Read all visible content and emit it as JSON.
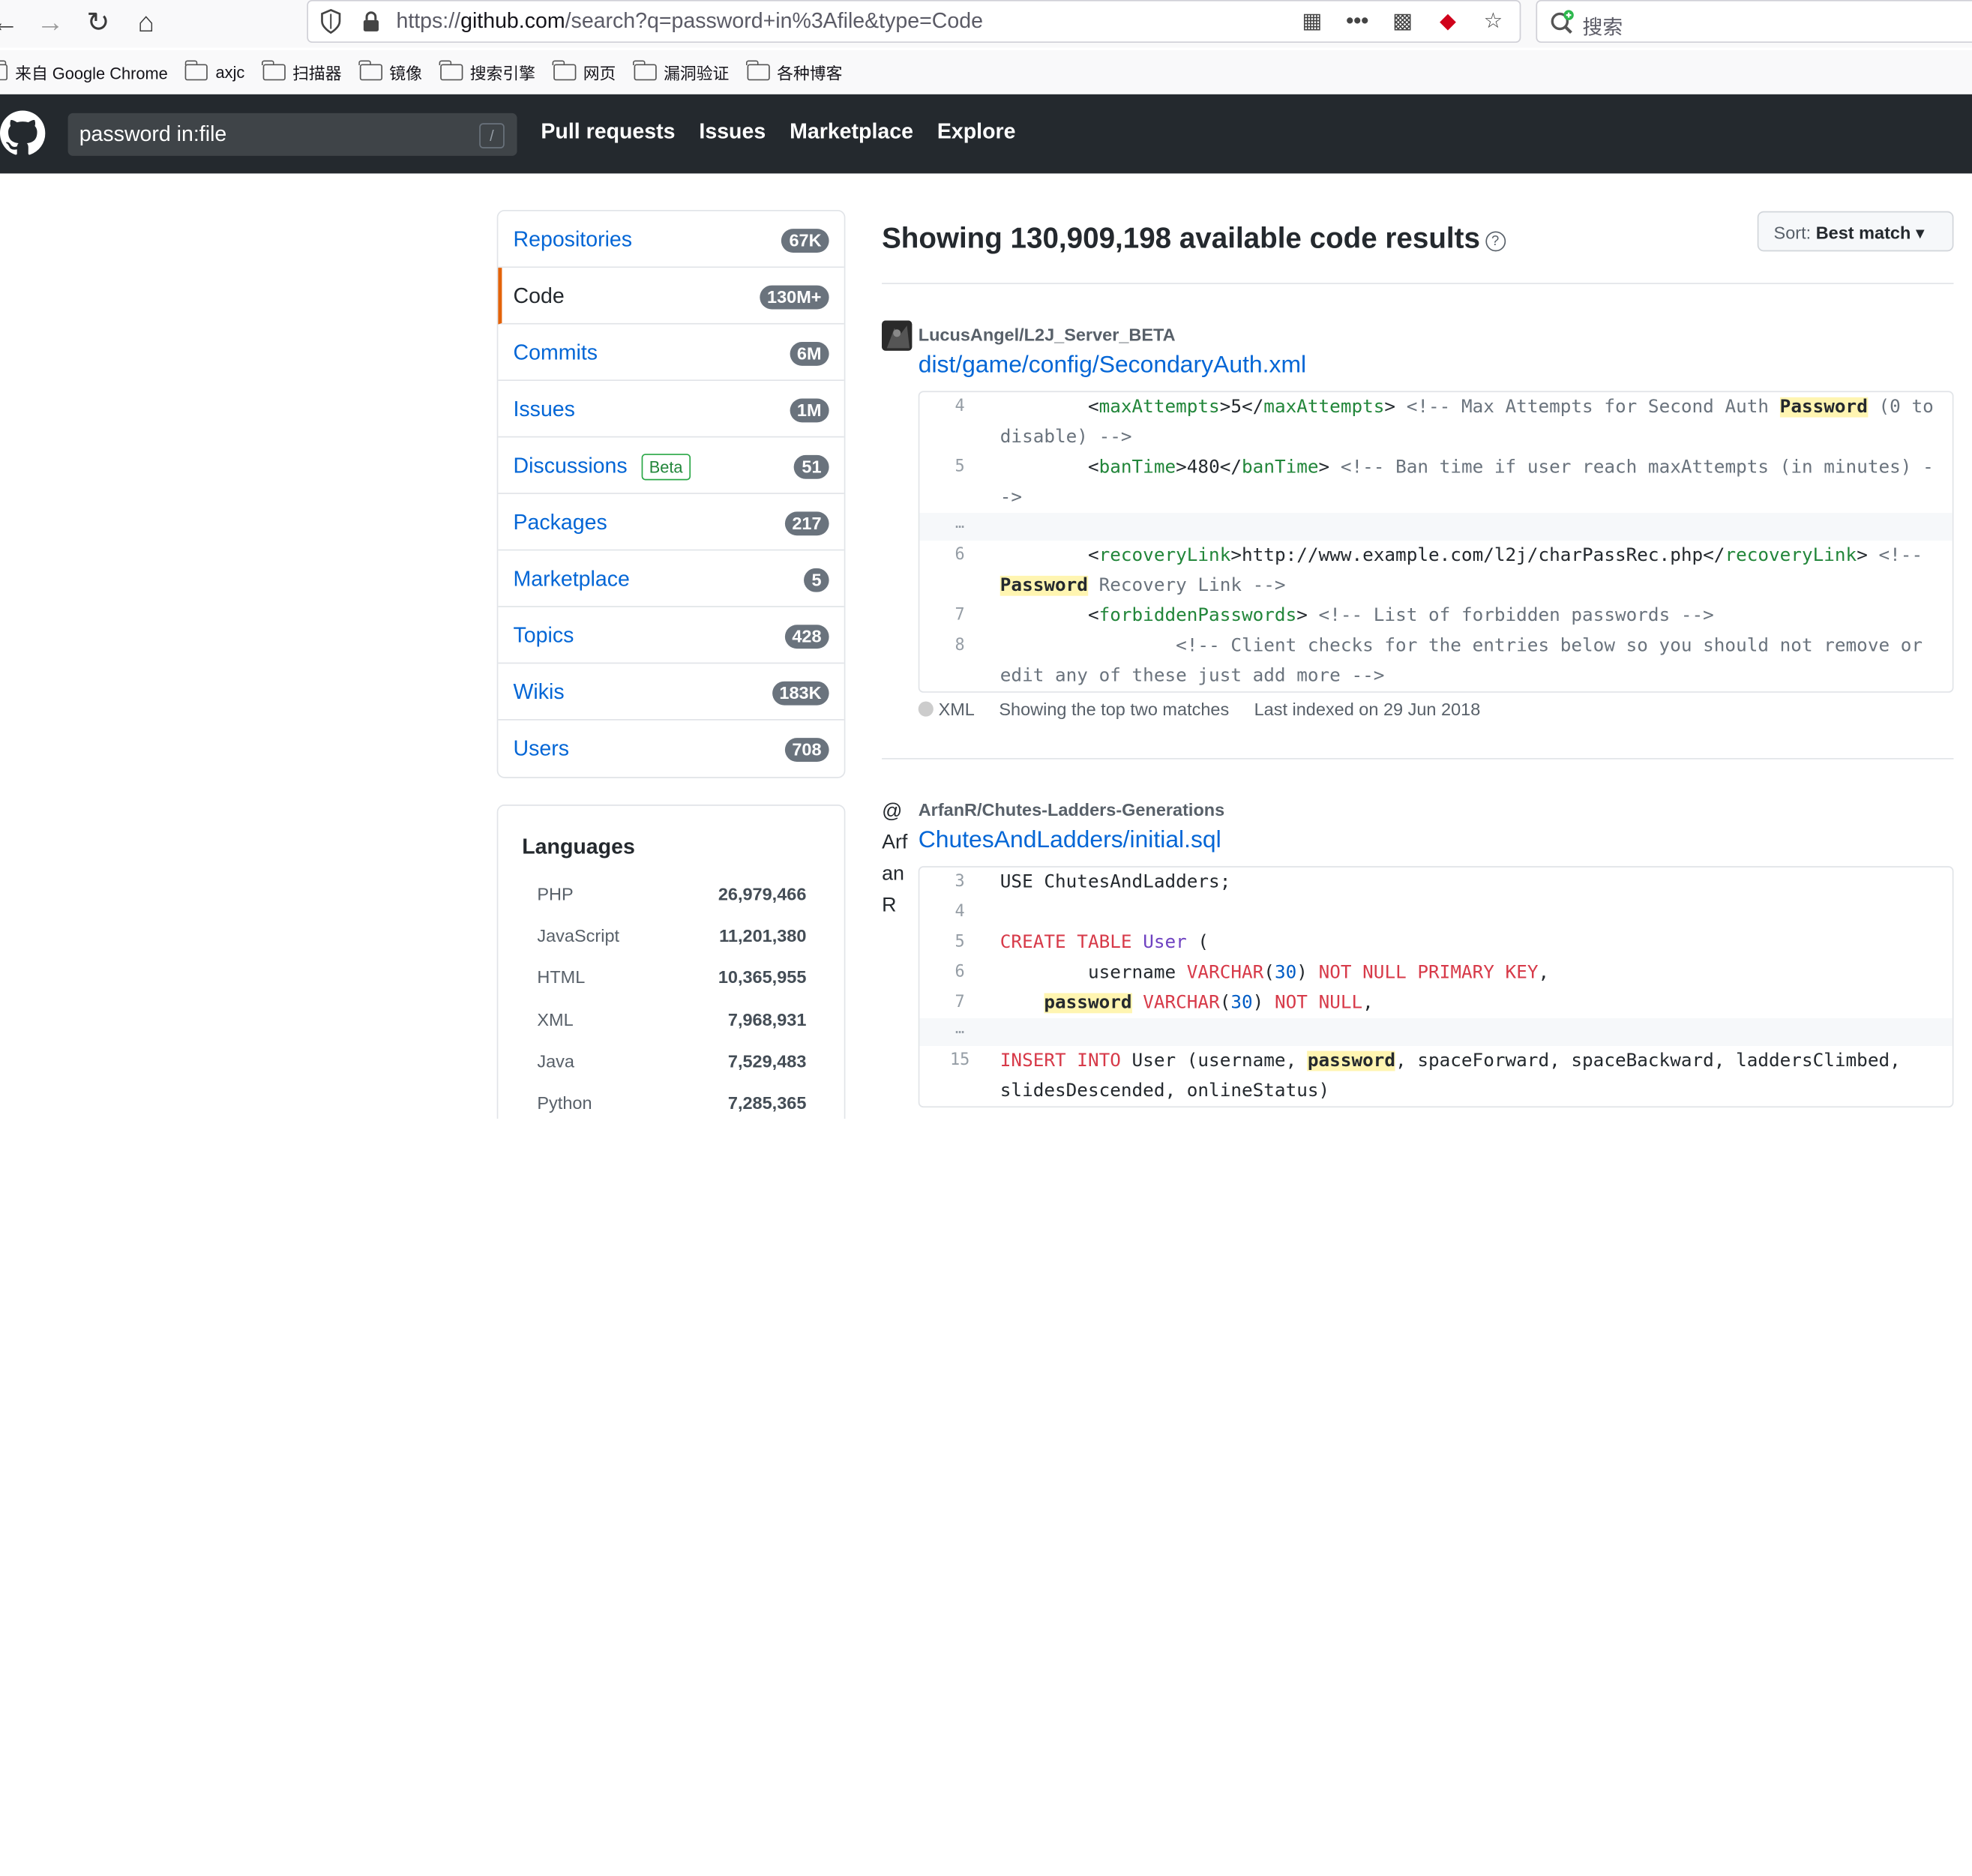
{
  "browser": {
    "url_prefix": "https://",
    "url_host": "github.com",
    "url_path": "/search?q=password+in%3Afile&type=Code",
    "search_placeholder": "搜索"
  },
  "bookmarks": [
    {
      "label": "来自 Google Chrome",
      "folder": false
    },
    {
      "label": "axjc",
      "folder": true
    },
    {
      "label": "扫描器",
      "folder": true
    },
    {
      "label": "镜像",
      "folder": true
    },
    {
      "label": "搜索引擎",
      "folder": true
    },
    {
      "label": "网页",
      "folder": true
    },
    {
      "label": "漏洞验证",
      "folder": true
    },
    {
      "label": "各种博客",
      "folder": true
    }
  ],
  "header": {
    "search_value": "password in:file",
    "slash_hint": "/",
    "nav": [
      "Pull requests",
      "Issues",
      "Marketplace",
      "Explore"
    ]
  },
  "sidebar": {
    "items": [
      {
        "label": "Repositories",
        "count": "67K"
      },
      {
        "label": "Code",
        "count": "130M+",
        "active": true
      },
      {
        "label": "Commits",
        "count": "6M"
      },
      {
        "label": "Issues",
        "count": "1M"
      },
      {
        "label": "Discussions",
        "count": "51",
        "badge": "Beta"
      },
      {
        "label": "Packages",
        "count": "217"
      },
      {
        "label": "Marketplace",
        "count": "5"
      },
      {
        "label": "Topics",
        "count": "428"
      },
      {
        "label": "Wikis",
        "count": "183K"
      },
      {
        "label": "Users",
        "count": "708"
      }
    ]
  },
  "languages": {
    "title": "Languages",
    "rows": [
      {
        "name": "PHP",
        "count": "26,979,466"
      },
      {
        "name": "JavaScript",
        "count": "11,201,380"
      },
      {
        "name": "HTML",
        "count": "10,365,955"
      },
      {
        "name": "XML",
        "count": "7,968,931"
      },
      {
        "name": "Java",
        "count": "7,529,483"
      },
      {
        "name": "Python",
        "count": "7,285,365"
      }
    ]
  },
  "results": {
    "title": "Showing 130,909,198 available code results",
    "sort_key": "Sort:",
    "sort_value": "Best match",
    "items": [
      {
        "repo": "LucusAngel/L2J_Server_BETA",
        "file": "dist/game/config/SecondaryAuth.xml",
        "language": "XML",
        "match_note": "Showing the top two matches",
        "indexed": "Last indexed on 29 Jun 2018"
      },
      {
        "repo": "ArfanR/Chutes-Ladders-Generations",
        "avatar_alt": "@ Arf an R",
        "file": "ChutesAndLadders/initial.sql"
      }
    ]
  },
  "colors": {
    "header_bg": "#24292e",
    "link": "#0366d6",
    "active_accent": "#e36209",
    "highlight": "#fff5b1"
  }
}
